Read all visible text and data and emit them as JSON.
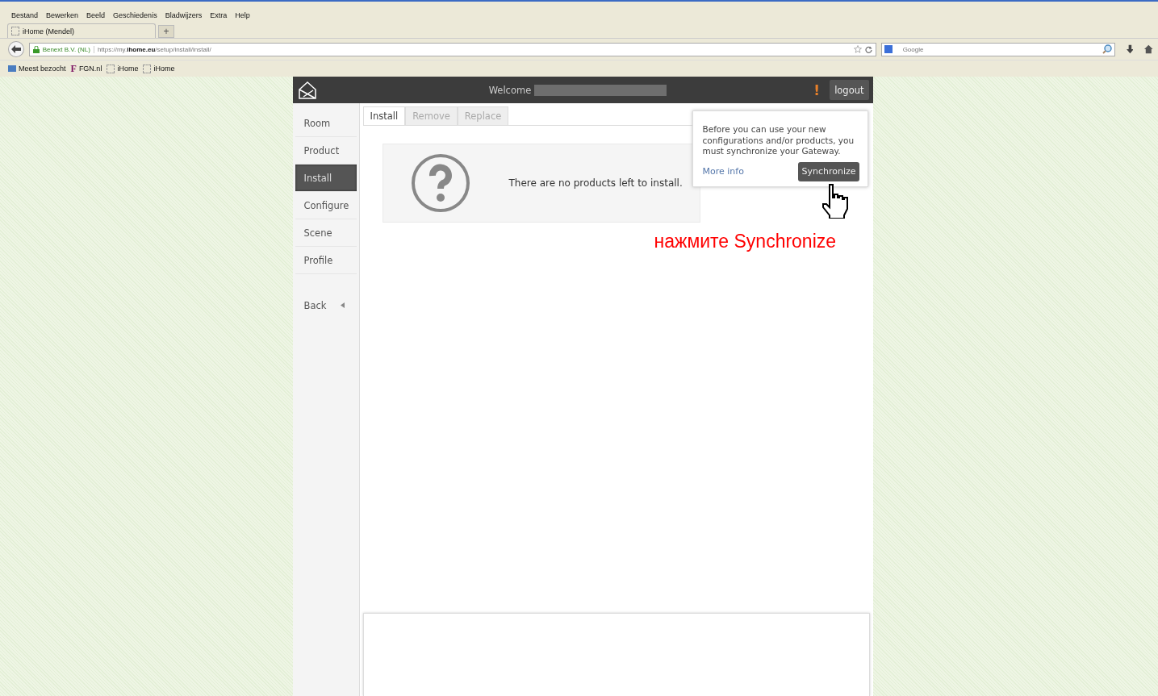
{
  "browser": {
    "menu": [
      "Bestand",
      "Bewerken",
      "Beeld",
      "Geschiedenis",
      "Bladwijzers",
      "Extra",
      "Help"
    ],
    "tabs": [
      {
        "label": "iHome (Mendel)",
        "selected": true
      }
    ],
    "new_tab": "+",
    "site_identity": "Benext B.V. (NL)",
    "url": {
      "prefix": "https://my.",
      "domain": "ihome.eu",
      "path": "/setup/install/install/"
    },
    "search": {
      "placeholder": "Google"
    },
    "bookmarks": [
      {
        "label": "Meest bezocht",
        "kind": "folder"
      },
      {
        "label": "FGN.nl",
        "kind": "letter",
        "icon": "F"
      },
      {
        "label": "iHome",
        "kind": "page"
      },
      {
        "label": "iHome",
        "kind": "page"
      }
    ]
  },
  "header": {
    "welcome": "Welcome",
    "alert": "!",
    "logout": "logout"
  },
  "sidebar": {
    "items": [
      {
        "label": "Room",
        "selected": false
      },
      {
        "label": "Product",
        "selected": false
      },
      {
        "label": "Install",
        "selected": true
      },
      {
        "label": "Configure",
        "selected": false
      },
      {
        "label": "Scene",
        "selected": false
      },
      {
        "label": "Profile",
        "selected": false
      }
    ],
    "back": "Back"
  },
  "tabs": [
    {
      "label": "Install",
      "selected": true
    },
    {
      "label": "Remove",
      "selected": false
    },
    {
      "label": "Replace",
      "selected": false
    }
  ],
  "empty_message": "There are no products left to install.",
  "popover": {
    "text": "Before you can use your new configurations and/or products, you must synchronize your Gateway.",
    "link": "More info",
    "button": "Synchronize"
  },
  "annotation": "нажмите Synchronize"
}
